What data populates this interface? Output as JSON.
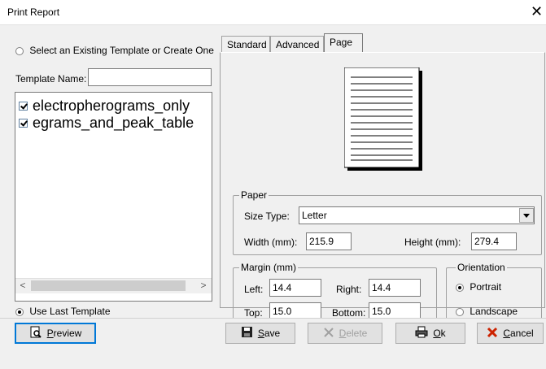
{
  "window": {
    "title": "Print Report",
    "close_glyph": "✕"
  },
  "left": {
    "select_radio_label": "Select an Existing Template or Create One",
    "template_name_label": "Template Name:",
    "template_name_value": "",
    "templates": [
      {
        "name": "electropherograms_only",
        "checked": true
      },
      {
        "name": "egrams_and_peak_table",
        "checked": true
      }
    ],
    "use_last_label": "Use Last Template",
    "scroll_left": "<",
    "scroll_right": ">"
  },
  "tabs": [
    {
      "label": "Standard",
      "active": false
    },
    {
      "label": "Advanced",
      "active": false
    },
    {
      "label": "Page",
      "active": true
    }
  ],
  "paper": {
    "legend": "Paper",
    "size_type_label": "Size Type:",
    "size_type_value": "Letter",
    "width_label": "Width (mm):",
    "width_value": "215.9",
    "height_label": "Height (mm):",
    "height_value": "279.4"
  },
  "margin": {
    "legend": "Margin (mm)",
    "left_label": "Left:",
    "left_value": "14.4",
    "right_label": "Right:",
    "right_value": "14.4",
    "top_label": "Top:",
    "top_value": "15.0",
    "bottom_label": "Bottom:",
    "bottom_value": "15.0"
  },
  "orientation": {
    "legend": "Orientation",
    "portrait_label": "Portrait",
    "landscape_label": "Landscape",
    "selected": "Portrait"
  },
  "buttons": {
    "preview_first": "P",
    "preview_rest": "review",
    "save_first": "S",
    "save_rest": "ave",
    "delete_first": "D",
    "delete_rest": "elete",
    "ok_first": "O",
    "ok_rest": "k",
    "cancel_first": "C",
    "cancel_rest": "ancel"
  },
  "colors": {
    "cancel_icon": "#cc2200",
    "focus_border": "#0078d7"
  }
}
